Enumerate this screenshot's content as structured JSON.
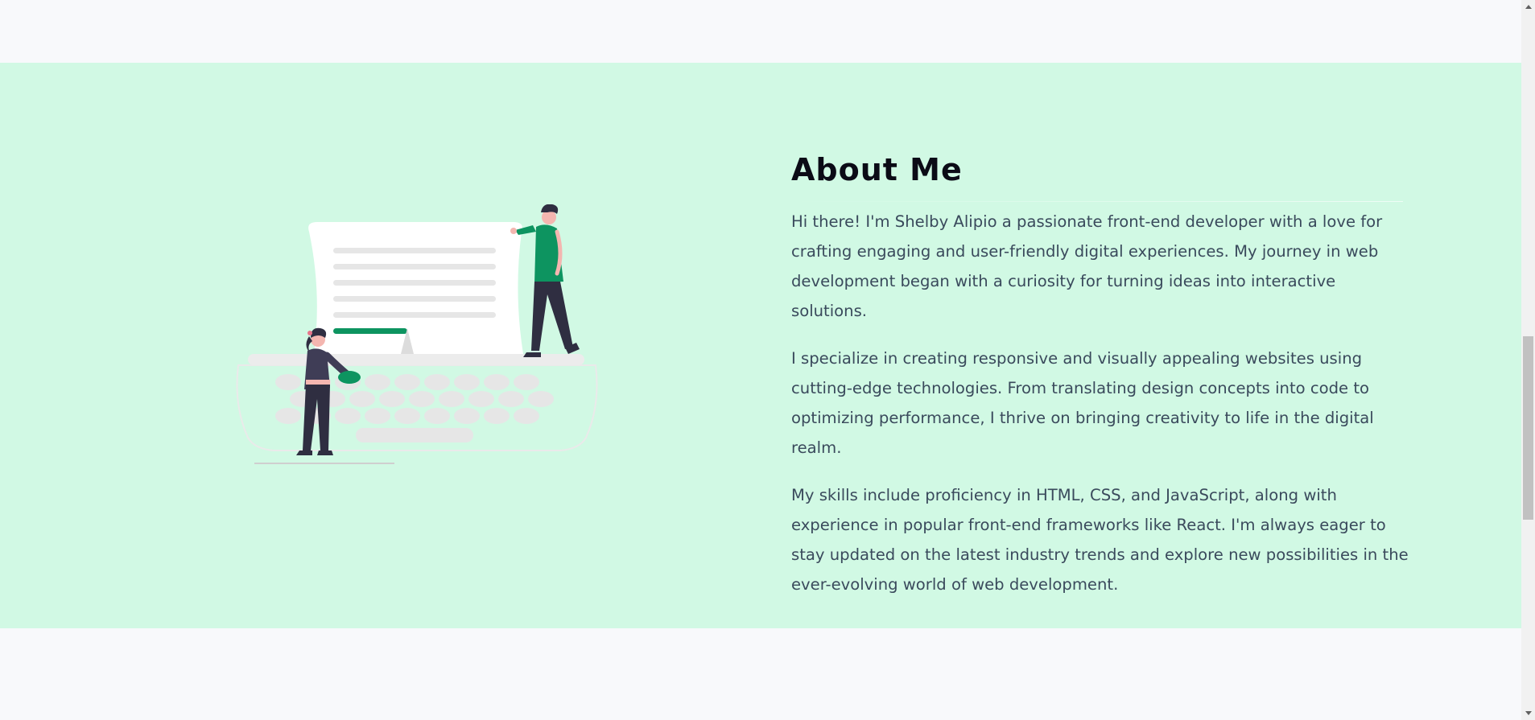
{
  "about": {
    "title": "About Me",
    "paragraphs": [
      "Hi there! I'm Shelby Alipio a passionate front-end developer with a love for crafting engaging and user-friendly digital experiences. My journey in web development began with a curiosity for turning ideas into interactive solutions.",
      "I specialize in creating responsive and visually appealing websites using cutting-edge technologies. From translating design concepts into code to optimizing performance, I thrive on bringing creativity to life in the digital realm.",
      "My skills include proficiency in HTML, CSS, and JavaScript, along with experience in popular front-end frameworks like React. I'm always eager to stay updated on the latest industry trends and explore new possibilities in the ever-evolving world of web development."
    ]
  },
  "illustration": {
    "icon": "typewriter-illustration-icon"
  },
  "colors": {
    "section_background": "#d1f9e4",
    "page_background": "#f8f9fb",
    "accent": "#0d9460",
    "title": "#0b0b16",
    "body_text": "#3a4a5c"
  }
}
